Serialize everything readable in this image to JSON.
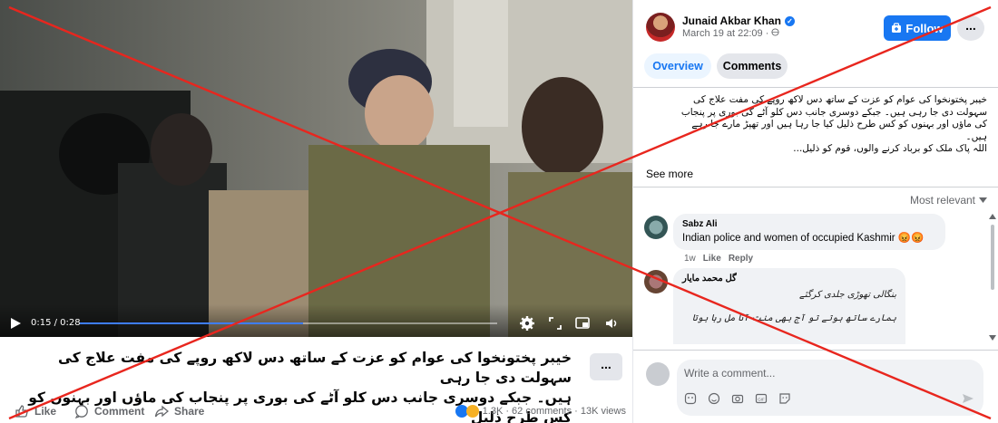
{
  "video": {
    "time_label": "0:15 / 0:28",
    "progress_fraction": 0.535
  },
  "caption": {
    "line1": "خیبر پختونخوا کی عوام کو عزت کے ساتھ دس لاکھ روپے کی مفت علاج کی سہولت دی جا رہی",
    "line2": "ہیں۔ جبکے دوسری جانب دس کلو آٹے کی بوری پر پنجاب کی ماؤں اور بہنوں کو کس طرح ذلیل",
    "more_label": "..."
  },
  "actions": {
    "like": "Like",
    "comment": "Comment",
    "share": "Share",
    "stats": "1.3K · 62 comments · 13K views"
  },
  "panel": {
    "author": "Junaid Akbar Khan",
    "date": "March 19 at 22:09 · ",
    "follow_label": "Follow",
    "more_label": "...",
    "tabs": [
      "Overview",
      "Comments"
    ],
    "post_text": [
      "خیبر پختونخوا کی عوام کو عزت کے ساتھ دس لاکھ روپے کی مفت علاج کی",
      "سہولت دی جا رہی ہیں۔ جبکے دوسری جانب دس کلو آٹے کی بوری پر پنجاب",
      "کی ماؤں اور بہنوں کو کس طرح ذلیل کیا جا رہا ہیں اور تھپڑ مارے جا رہے",
      "ہیں۔",
      "اللہ پاک ملک کو برباد کرنے والوں، قوم کو ذلیل..."
    ],
    "see_more": "See more",
    "sort_label": "Most relevant",
    "comments": [
      {
        "name": "Sabz Ali",
        "text": "Indian police and women of occupied Kashmir 😡😡",
        "time": "1w",
        "like": "Like",
        "reply": "Reply"
      },
      {
        "name": "گل محمد مایار",
        "lines": [
          "بنگالی تھوڑی جلدی کرگئے",
          "ہمارے ساتھ ہوتے تو آج بھی منت آٹا مل رہا ہوتا"
        ]
      }
    ],
    "composer_placeholder": "Write a comment..."
  },
  "colors": {
    "accent": "#1877f2",
    "overlay_x": "#e8261e",
    "progress": "#3e7dff"
  }
}
